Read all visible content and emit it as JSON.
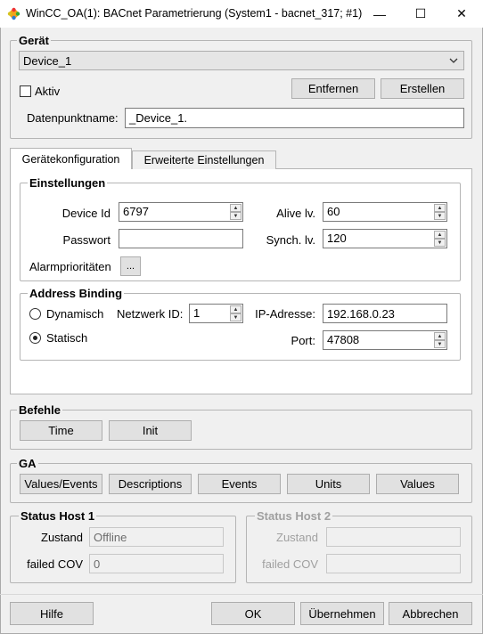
{
  "window": {
    "title": "WinCC_OA(1): BACnet Parametrierung (System1 - bacnet_317; #1)",
    "minimize": "—",
    "maximize": "☐",
    "close": "✕"
  },
  "geraet": {
    "title": "Gerät",
    "device_select": "Device_1",
    "aktiv_label": "Aktiv",
    "aktiv_checked": false,
    "remove_button": "Entfernen",
    "create_button": "Erstellen",
    "datapoint_label": "Datenpunktname:",
    "datapoint_value": "_Device_1."
  },
  "tabs": [
    {
      "label": "Gerätekonfiguration",
      "active": true
    },
    {
      "label": "Erweiterte Einstellungen",
      "active": false
    }
  ],
  "einstellungen": {
    "title": "Einstellungen",
    "device_id_label": "Device Id",
    "device_id_value": "6797",
    "password_label": "Passwort",
    "password_value": "",
    "alarm_label": "Alarmprioritäten",
    "alarm_button": "...",
    "alive_label": "Alive lv.",
    "alive_value": "60",
    "synch_label": "Synch. lv.",
    "synch_value": "120"
  },
  "address_binding": {
    "title": "Address Binding",
    "dynamic_label": "Dynamisch",
    "static_label": "Statisch",
    "selected": "Statisch",
    "network_label": "Netzwerk ID:",
    "network_value": "1",
    "ip_label": "IP-Adresse:",
    "ip_value": "192.168.0.23",
    "port_label": "Port:",
    "port_value": "47808"
  },
  "befehle": {
    "title": "Befehle",
    "buttons": [
      "Time",
      "Init"
    ]
  },
  "ga": {
    "title": "GA",
    "buttons": [
      "Values/Events",
      "Descriptions",
      "Events",
      "Units",
      "Values"
    ]
  },
  "status1": {
    "title": "Status Host 1",
    "zustand_label": "Zustand",
    "zustand_value": "Offline",
    "cov_label": "failed COV",
    "cov_value": "0"
  },
  "status2": {
    "title": "Status Host 2",
    "zustand_label": "Zustand",
    "zustand_value": "",
    "cov_label": "failed COV",
    "cov_value": ""
  },
  "footer": {
    "help": "Hilfe",
    "ok": "OK",
    "apply": "Übernehmen",
    "cancel": "Abbrechen"
  }
}
